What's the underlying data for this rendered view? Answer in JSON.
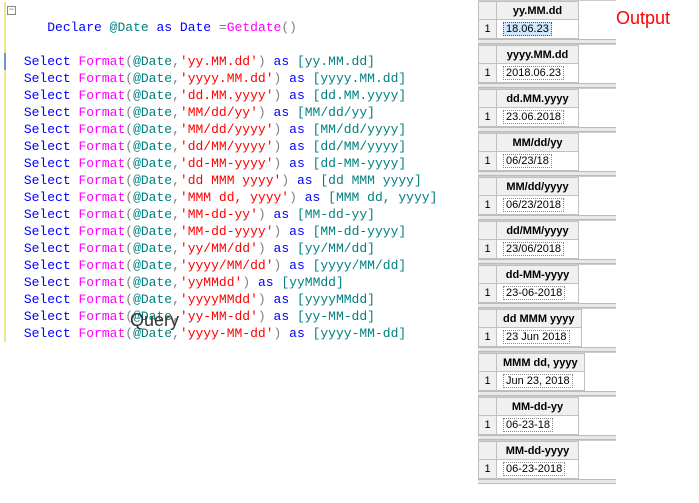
{
  "labels": {
    "query": "Query",
    "output": "Output"
  },
  "code": {
    "declare": {
      "kw1": "Declare",
      "var": "@Date",
      "kw2": "as",
      "type": "Date",
      "eq": "=",
      "fn": "Getdate",
      "lp": "(",
      "rp": ")"
    },
    "select_kw": "Select",
    "format_fn": "Format",
    "as_kw": "as",
    "var_ref": "@Date",
    "comma_sp": ",",
    "lines": [
      {
        "fmt": "'yy.MM.dd'",
        "alias": "[yy.MM.dd]"
      },
      {
        "fmt": "'yyyy.MM.dd'",
        "alias": "[yyyy.MM.dd]"
      },
      {
        "fmt": "'dd.MM.yyyy'",
        "alias": "[dd.MM.yyyy]"
      },
      {
        "fmt": "'MM/dd/yy'",
        "alias": "[MM/dd/yy]"
      },
      {
        "fmt": "'MM/dd/yyyy'",
        "alias": "[MM/dd/yyyy]"
      },
      {
        "fmt": "'dd/MM/yyyy'",
        "alias": "[dd/MM/yyyy]"
      },
      {
        "fmt": "'dd-MM-yyyy'",
        "alias": "[dd-MM-yyyy]"
      },
      {
        "fmt": "'dd MMM yyyy'",
        "alias": "[dd MMM yyyy]"
      },
      {
        "fmt": "'MMM dd, yyyy'",
        "alias": "[MMM dd, yyyy]"
      },
      {
        "fmt": "'MM-dd-yy'",
        "alias": "[MM-dd-yy]"
      },
      {
        "fmt": "'MM-dd-yyyy'",
        "alias": "[MM-dd-yyyy]"
      },
      {
        "fmt": "'yy/MM/dd'",
        "alias": "[yy/MM/dd]"
      },
      {
        "fmt": "'yyyy/MM/dd'",
        "alias": "[yyyy/MM/dd]"
      },
      {
        "fmt": "'yyMMdd'",
        "alias": "[yyMMdd]"
      },
      {
        "fmt": "'yyyyMMdd'",
        "alias": "[yyyyMMdd]"
      },
      {
        "fmt": "'yy-MM-dd'",
        "alias": "[yy-MM-dd]"
      },
      {
        "fmt": "'yyyy-MM-dd'",
        "alias": "[yyyy-MM-dd]"
      }
    ]
  },
  "results": [
    {
      "header": "yy.MM.dd",
      "row": "1",
      "value": "18.06.23",
      "selected": true
    },
    {
      "header": "yyyy.MM.dd",
      "row": "1",
      "value": "2018.06.23"
    },
    {
      "header": "dd.MM.yyyy",
      "row": "1",
      "value": "23.06.2018"
    },
    {
      "header": "MM/dd/yy",
      "row": "1",
      "value": "06/23/18"
    },
    {
      "header": "MM/dd/yyyy",
      "row": "1",
      "value": "06/23/2018"
    },
    {
      "header": "dd/MM/yyyy",
      "row": "1",
      "value": "23/06/2018"
    },
    {
      "header": "dd-MM-yyyy",
      "row": "1",
      "value": "23-06-2018"
    },
    {
      "header": "dd MMM yyyy",
      "row": "1",
      "value": "23 Jun 2018"
    },
    {
      "header": "MMM dd, yyyy",
      "row": "1",
      "value": "Jun 23, 2018"
    },
    {
      "header": "MM-dd-yy",
      "row": "1",
      "value": "06-23-18"
    },
    {
      "header": "MM-dd-yyyy",
      "row": "1",
      "value": "06-23-2018"
    }
  ]
}
